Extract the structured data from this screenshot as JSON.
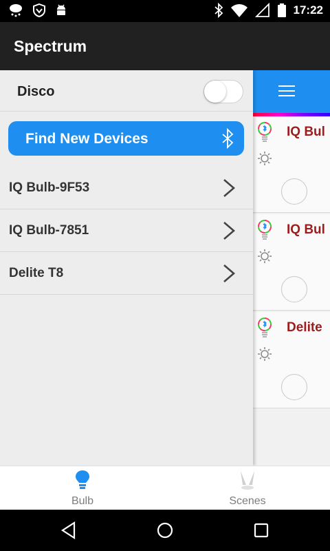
{
  "status_bar": {
    "time": "17:22"
  },
  "app_bar": {
    "title": "Spectrum"
  },
  "drawer": {
    "disco": {
      "label": "Disco",
      "enabled": false
    },
    "find_button": {
      "label": "Find New Devices"
    },
    "devices": [
      {
        "label": "IQ Bulb-9F53"
      },
      {
        "label": "IQ Bulb-7851"
      },
      {
        "label": "Delite T8"
      }
    ]
  },
  "right_panel": {
    "cards": [
      {
        "name": "IQ Bul"
      },
      {
        "name": "IQ Bul"
      },
      {
        "name": "Delite"
      }
    ]
  },
  "tabs": [
    {
      "label": "Bulb",
      "selected": true
    },
    {
      "label": "Scenes",
      "selected": false
    }
  ],
  "colors": {
    "accent": "#1e8ff0",
    "app_bar": "#212121",
    "device_name": "#a01c1c"
  },
  "icons": {
    "status_left": [
      "weather-rain-icon",
      "shield-icon",
      "android-icon"
    ],
    "status_right": [
      "bluetooth-icon",
      "wifi-icon",
      "signal-icon",
      "battery-icon"
    ]
  }
}
